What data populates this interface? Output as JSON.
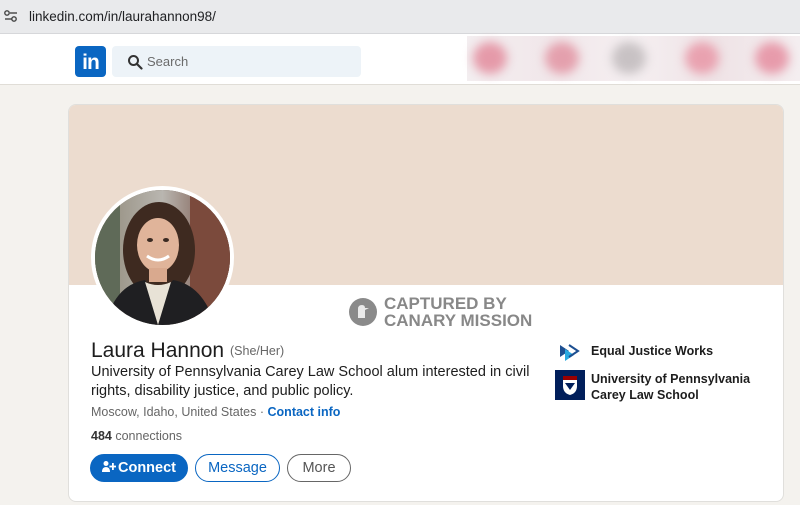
{
  "browser": {
    "url": "linkedin.com/in/laurahannon98/"
  },
  "nav": {
    "logo": "in",
    "search_placeholder": "Search"
  },
  "watermark": {
    "line1": "CAPTURED BY",
    "line2": "CANARY MISSION"
  },
  "profile": {
    "name": "Laura Hannon",
    "pronouns": "(She/Her)",
    "headline": "University of Pennsylvania Carey Law School alum interested in civil rights, disability justice, and public policy.",
    "location": "Moscow, Idaho, United States",
    "separator": "·",
    "contact_info": "Contact info",
    "connections_count": "484",
    "connections_label": "connections"
  },
  "actions": {
    "connect": "Connect",
    "message": "Message",
    "more": "More"
  },
  "organizations": [
    {
      "name": "Equal Justice Works",
      "icon": "equal-justice-works-logo"
    },
    {
      "name": "University of Pennsylvania Carey Law School",
      "icon": "penn-shield-logo"
    }
  ],
  "colors": {
    "linkedin_blue": "#0a66c2",
    "banner": "#ecdccf",
    "page_bg": "#f4f2ee"
  }
}
